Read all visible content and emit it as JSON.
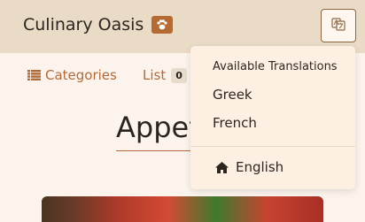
{
  "navbar": {
    "brand": "Culinary Oasis",
    "brand_badge_icon": "paw-icon",
    "translate_icon": "translate-icon",
    "accent_color": "#b46a34"
  },
  "subnav": {
    "categories_label": "Categories",
    "categories_icon": "list-icon",
    "list_label": "List",
    "list_count": "0"
  },
  "main": {
    "title": "Appet"
  },
  "translations": {
    "header": "Available Translations",
    "options": [
      "Greek",
      "French"
    ],
    "current": "English",
    "current_icon": "home-icon"
  }
}
